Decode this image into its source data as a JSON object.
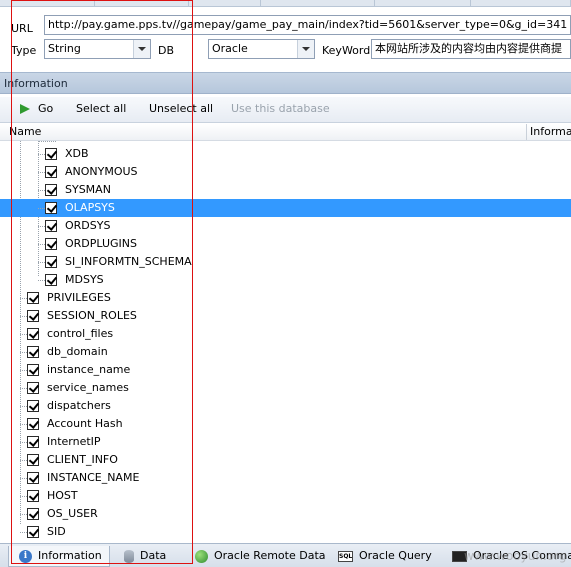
{
  "form": {
    "url_label": "URL",
    "url_value": "http://pay.game.pps.tv//gamepay/game_pay_main/index?tid=5601&server_type=0&g_id=341",
    "type_label": "Type",
    "type_value": "String",
    "db_label": "DB",
    "db_value": "Oracle",
    "keyword_label": "KeyWord",
    "keyword_value": "本网站所涉及的内容均由内容提供商提"
  },
  "panel": {
    "title": "Information"
  },
  "toolbar": {
    "go_label": "Go",
    "select_all_label": "Select all",
    "unselect_all_label": "Unselect all",
    "use_db_label": "Use this database"
  },
  "columns": {
    "name": "Name",
    "information": "Informat"
  },
  "tree": {
    "children": [
      "XDB",
      "ANONYMOUS",
      "SYSMAN",
      "OLAPSYS",
      "ORDSYS",
      "ORDPLUGINS",
      "SI_INFORMTN_SCHEMA",
      "MDSYS"
    ],
    "selected": "OLAPSYS",
    "top_items": [
      "PRIVILEGES",
      "SESSION_ROLES",
      "control_files",
      "db_domain",
      "instance_name",
      "service_names",
      "dispatchers",
      "Account Hash",
      "InternetIP",
      "CLIENT_INFO",
      "INSTANCE_NAME",
      "HOST",
      "OS_USER",
      "SID"
    ]
  },
  "status_tabs": [
    {
      "label": "Information",
      "icon": "info-icon"
    },
    {
      "label": "Data",
      "icon": "database-icon"
    },
    {
      "label": "Oracle Remote Data",
      "icon": "globe-icon"
    },
    {
      "label": "Oracle Query",
      "icon": "sql-icon"
    },
    {
      "label": "Oracle OS Command",
      "icon": "terminal-icon"
    }
  ],
  "watermark": "www.wooyun.org",
  "colors": {
    "selection": "#3399ff",
    "annotation_box": "#dd1111",
    "toolbar_go": "#2f9a2f"
  }
}
